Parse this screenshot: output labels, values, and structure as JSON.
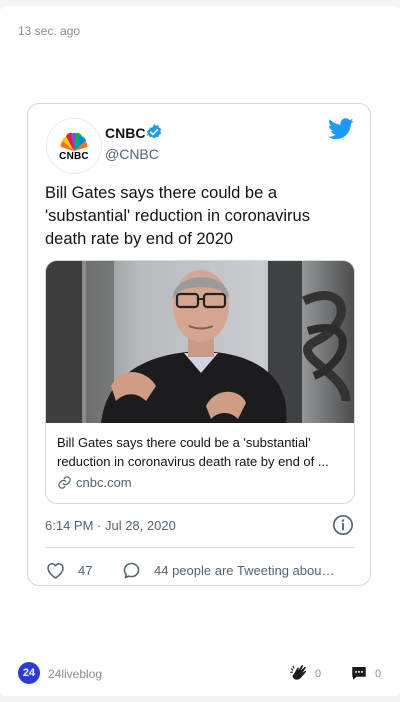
{
  "post": {
    "time_ago": "13 sec. ago"
  },
  "tweet": {
    "avatar_label": "CNBC",
    "name": "CNBC",
    "handle": "@CNBC",
    "text": "Bill Gates says there could be a 'substantial' reduction in coronavirus death rate by end of 2020",
    "link_card": {
      "title": "Bill Gates says there could be a 'substantial' reduction in coronavirus death rate by end of ...",
      "domain": "cnbc.com"
    },
    "date": "6:14 PM · Jul 28, 2020",
    "like_count": "47",
    "reply_text": "44 people are Tweeting abou…",
    "colors": {
      "twitter_blue": "#1d9bf0",
      "secondary_text": "#536471",
      "border": "#cfd9de"
    },
    "icons": [
      "twitter-bird-icon",
      "verified-badge-icon",
      "link-icon",
      "info-icon",
      "heart-icon",
      "reply-bubble-icon"
    ]
  },
  "footer": {
    "logo_text": "24",
    "brand": "24liveblog",
    "clap_count": "0",
    "comment_count": "0",
    "icons": [
      "clap-icon",
      "comment-icon"
    ]
  }
}
